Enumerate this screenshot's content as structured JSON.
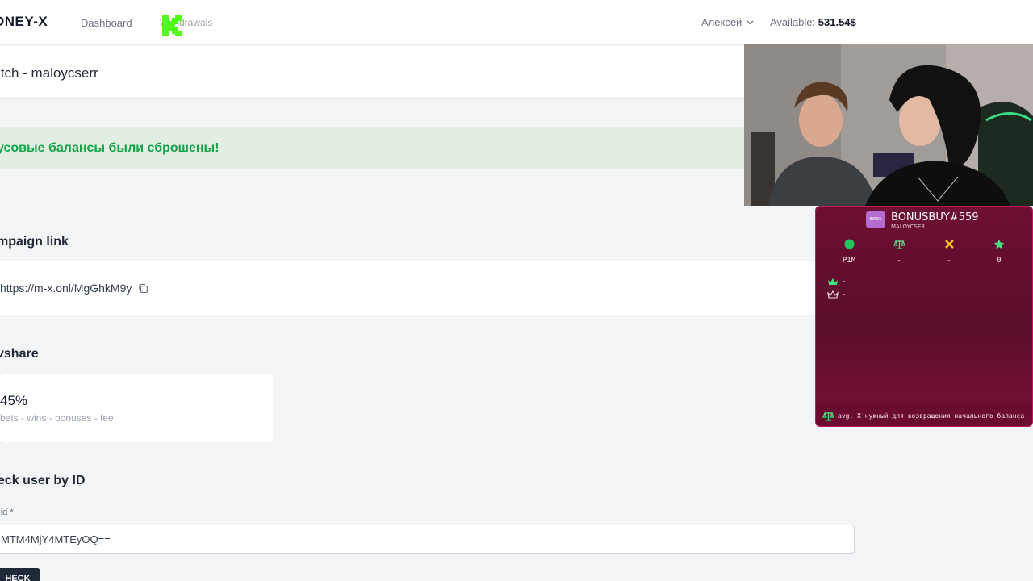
{
  "header": {
    "brand": "ONEY-X",
    "nav_dashboard": "Dashboard",
    "nav_withdrawals": "Withdrawals",
    "user_name": "Алексей",
    "available_label": "Available:",
    "available_value": "531.54$"
  },
  "page": {
    "title": "itch - maloycserr"
  },
  "alert": {
    "message": "усовые балансы были сброшены!"
  },
  "campaign": {
    "section_title": "mpaign link",
    "link": "https://m-x.onl/MgGhkM9y"
  },
  "revshare": {
    "section_title": "vshare",
    "percent": "45%",
    "formula": "bets - wins - bonuses - fee"
  },
  "check_user": {
    "section_title": "eck user by ID",
    "field_label": "r id *",
    "field_value": "MTM4MjY4MTEyOQ==",
    "button_label": "HECK"
  },
  "widget": {
    "badge": "BONUS",
    "title": "BONUSBUY#559",
    "subtitle": "MALOYCSER",
    "stats": [
      {
        "icon": "green-dot-icon",
        "value": "P1M"
      },
      {
        "icon": "balance-scale-icon",
        "value": "-"
      },
      {
        "icon": "x-mark-icon",
        "value": "-"
      },
      {
        "icon": "star-icon",
        "value": "0"
      }
    ],
    "rows": [
      {
        "icon": "crown-green-icon",
        "value": "-"
      },
      {
        "icon": "crown-white-icon",
        "value": "-"
      }
    ],
    "footer": "avg. X нужный для возвращения начального баланса"
  },
  "colors": {
    "accent_green": "#16a34a",
    "widget_bg": "#6e0f33",
    "widget_border": "#c2185b"
  }
}
